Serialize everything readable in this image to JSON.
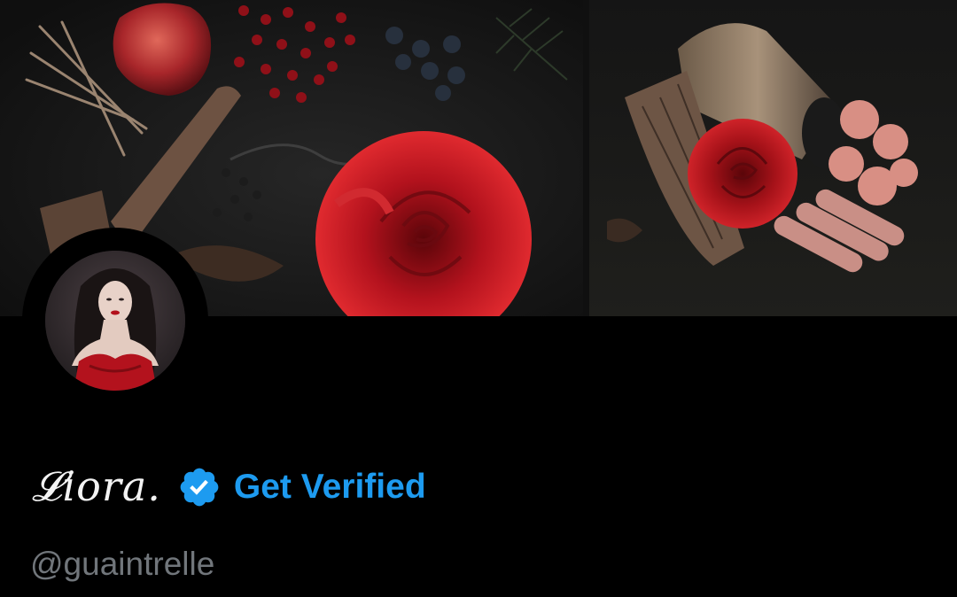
{
  "profile": {
    "display_name": "𝓛iora.",
    "verified_icon": "verified-badge-icon",
    "get_verified_label": "Get Verified",
    "handle": "@guaintrelle"
  },
  "colors": {
    "background": "#000000",
    "accent": "#1d9bf0",
    "handle": "#71767b",
    "rose": "#b3121d"
  }
}
